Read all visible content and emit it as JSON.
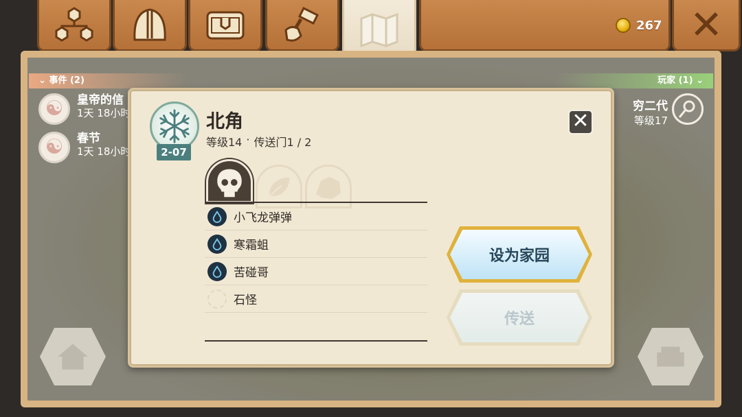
{
  "top_tabs": [
    {
      "name": "family-tree",
      "icon": "hierarchy-icon"
    },
    {
      "name": "equipment",
      "icon": "helmet-icon"
    },
    {
      "name": "chest",
      "icon": "treasure-chest-icon"
    },
    {
      "name": "crafting",
      "icon": "hammer-hand-icon"
    },
    {
      "name": "map",
      "icon": "map-icon",
      "active": true
    }
  ],
  "coins": {
    "icon": "gold-coin-icon",
    "amount": "267"
  },
  "close_icon": "close-x-icon",
  "events": {
    "header": "事件 (2)",
    "items": [
      {
        "title": "皇帝的信",
        "time": "1天 18小时",
        "icon": "yin-yang-icon"
      },
      {
        "title": "春节",
        "time": "1天 18小时",
        "icon": "yin-yang-icon"
      }
    ]
  },
  "players": {
    "header": "玩家 (1)",
    "items": [
      {
        "name": "穷二代",
        "level": "等级17",
        "icon": "pin-icon"
      }
    ]
  },
  "popup": {
    "emblem_icon": "snowflake-icon",
    "badge": "2-07",
    "title": "北角",
    "level": "等级14",
    "separator": "·",
    "portal": "传送门1 / 2",
    "category_tabs": [
      {
        "icon": "skull-icon",
        "active": true
      },
      {
        "icon": "leaf-icon",
        "active": false
      },
      {
        "icon": "rock-icon",
        "active": false
      }
    ],
    "monsters": [
      {
        "name": "小飞龙弹弹",
        "icon": "water-drop-icon"
      },
      {
        "name": "寒霜蛆",
        "icon": "water-drop-icon"
      },
      {
        "name": "苦碰哥",
        "icon": "water-drop-icon"
      },
      {
        "name": "石怪",
        "icon": "empty-slot-icon"
      }
    ],
    "set_home_label": "设为家园",
    "teleport_label": "传送"
  },
  "colors": {
    "wood": "#b57138",
    "parchment": "#f1e8d4",
    "teal": "#4b7f7e",
    "gold": "#e0b23b"
  }
}
